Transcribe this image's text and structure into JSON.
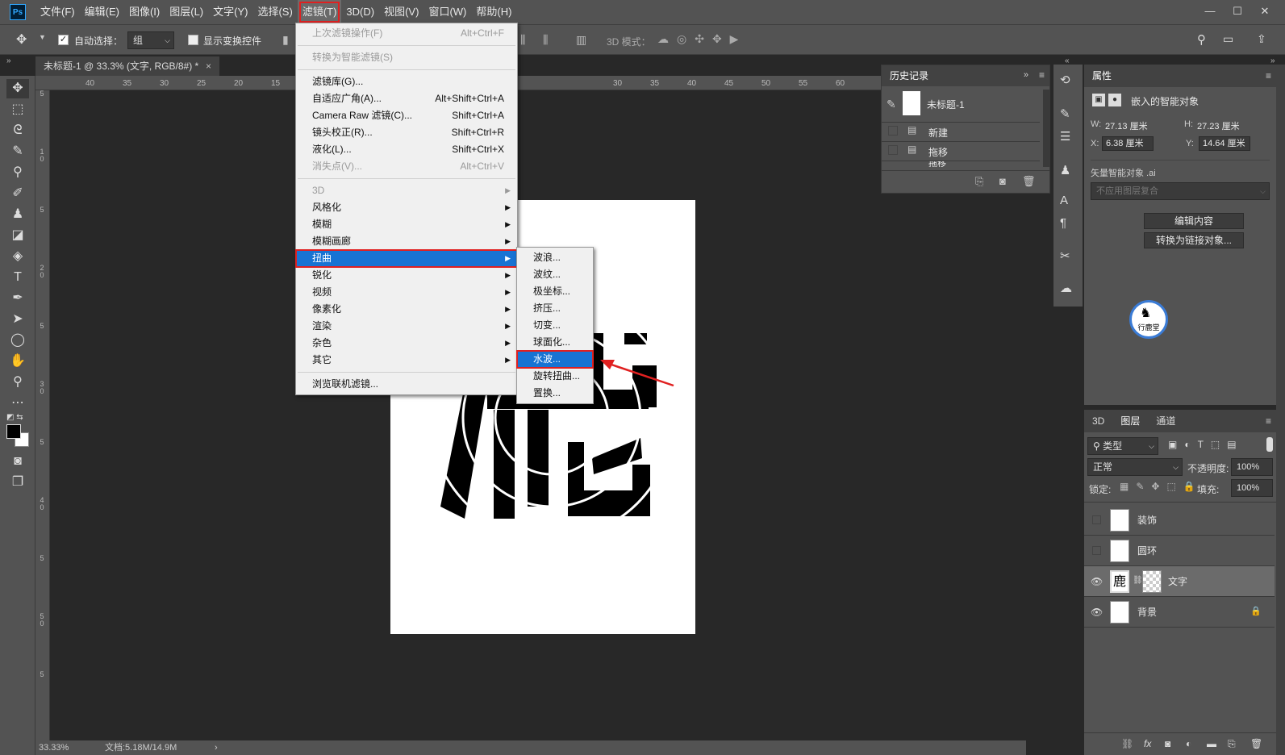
{
  "menubar": {
    "logo": "Ps",
    "items": [
      "文件(F)",
      "编辑(E)",
      "图像(I)",
      "图层(L)",
      "文字(Y)",
      "选择(S)",
      "滤镜(T)",
      "3D(D)",
      "视图(V)",
      "窗口(W)",
      "帮助(H)"
    ],
    "active_index": 6,
    "window_controls": [
      "—",
      "☐",
      "✕"
    ]
  },
  "options": {
    "auto_select_label": "自动选择：",
    "auto_select_value": "组",
    "show_transform_label": "显示变换控件",
    "mode_3d_label": "3D 模式："
  },
  "document": {
    "tab_title": "未标题-1 @ 33.3% (文字, RGB/8#) *",
    "close": "×"
  },
  "ruler": {
    "h_ticks": [
      "40",
      "35",
      "30",
      "25",
      "20",
      "15",
      "30",
      "35",
      "40",
      "45",
      "50",
      "55",
      "60"
    ],
    "v_ticks": [
      "5",
      "1 0",
      "5",
      "2 0",
      "5",
      "3 0",
      "5",
      "4 0",
      "5",
      "5 0",
      "5"
    ]
  },
  "status": {
    "zoom": "33.33%",
    "doc_info": "文档:5.18M/14.9M",
    "arrow": "›"
  },
  "filter_menu": {
    "items": [
      {
        "label": "上次滤镜操作(F)",
        "shortcut": "Alt+Ctrl+F",
        "disabled": true
      },
      {
        "sep": true
      },
      {
        "label": "转换为智能滤镜(S)",
        "disabled": true
      },
      {
        "sep": true
      },
      {
        "label": "滤镜库(G)..."
      },
      {
        "label": "自适应广角(A)...",
        "shortcut": "Alt+Shift+Ctrl+A"
      },
      {
        "label": "Camera Raw 滤镜(C)...",
        "shortcut": "Shift+Ctrl+A"
      },
      {
        "label": "镜头校正(R)...",
        "shortcut": "Shift+Ctrl+R"
      },
      {
        "label": "液化(L)...",
        "shortcut": "Shift+Ctrl+X"
      },
      {
        "label": "消失点(V)...",
        "shortcut": "Alt+Ctrl+V",
        "disabled": true
      },
      {
        "sep": true
      },
      {
        "label": "3D",
        "sub": true,
        "disabled": true
      },
      {
        "label": "风格化",
        "sub": true
      },
      {
        "label": "模糊",
        "sub": true
      },
      {
        "label": "模糊画廊",
        "sub": true
      },
      {
        "label": "扭曲",
        "sub": true,
        "highlight": true
      },
      {
        "label": "锐化",
        "sub": true
      },
      {
        "label": "视频",
        "sub": true
      },
      {
        "label": "像素化",
        "sub": true
      },
      {
        "label": "渲染",
        "sub": true
      },
      {
        "label": "杂色",
        "sub": true
      },
      {
        "label": "其它",
        "sub": true
      },
      {
        "sep": true
      },
      {
        "label": "浏览联机滤镜..."
      }
    ]
  },
  "distort_submenu": {
    "items": [
      {
        "label": "波浪..."
      },
      {
        "label": "波纹..."
      },
      {
        "label": "极坐标..."
      },
      {
        "label": "挤压..."
      },
      {
        "label": "切变..."
      },
      {
        "label": "球面化..."
      },
      {
        "label": "水波...",
        "highlight": true
      },
      {
        "label": "旋转扭曲..."
      },
      {
        "label": "置换..."
      }
    ]
  },
  "history": {
    "title": "历史记录",
    "snapshot": "未标题-1",
    "items": [
      "新建",
      "拖移",
      "拖移"
    ]
  },
  "properties": {
    "title": "属性",
    "subtitle": "嵌入的智能对象",
    "w_label": "W:",
    "w_value": "27.13 厘米",
    "h_label": "H:",
    "h_value": "27.23 厘米",
    "x_label": "X:",
    "x_value": "6.38 厘米",
    "y_label": "Y:",
    "y_value": "14.64 厘米",
    "vector_label": "矢量智能对象 .ai",
    "comp_placeholder": "不应用图层复合",
    "edit_button": "编辑内容",
    "convert_button": "转换为链接对象...",
    "logo_text": "行鹿堂"
  },
  "layers": {
    "tabs": [
      "3D",
      "图层",
      "通道"
    ],
    "active_tab": 1,
    "filter_kind": "类型",
    "blend_mode": "正常",
    "opacity_label": "不透明度:",
    "opacity_value": "100%",
    "lock_label": "锁定:",
    "fill_label": "填充:",
    "fill_value": "100%",
    "items": [
      {
        "name": "装饰",
        "visible": false
      },
      {
        "name": "圆环",
        "visible": false
      },
      {
        "name": "文字",
        "visible": true,
        "selected": true,
        "thumb": "鹿"
      },
      {
        "name": "背景",
        "visible": true,
        "locked": true
      }
    ],
    "footer_icons": [
      "link-icon",
      "fx-icon",
      "mask-icon",
      "adjustment-icon",
      "folder-icon",
      "new-layer-icon",
      "trash-icon"
    ],
    "fx": "fx"
  }
}
